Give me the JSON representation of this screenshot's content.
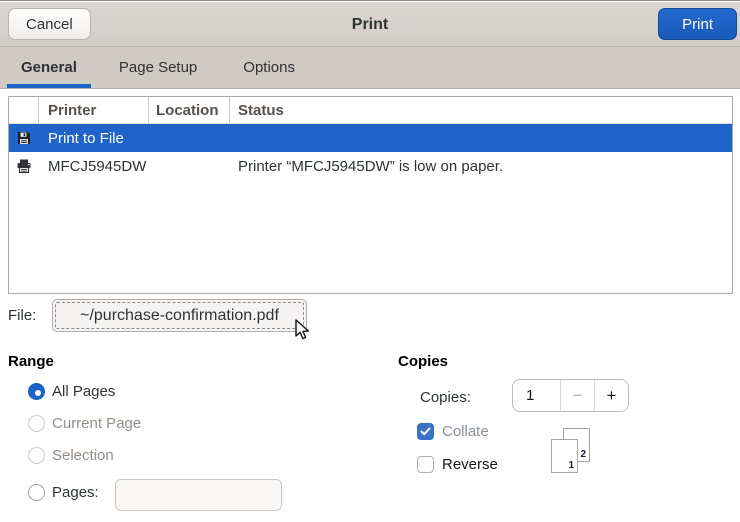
{
  "header": {
    "cancel_label": "Cancel",
    "title": "Print",
    "print_label": "Print"
  },
  "tabs": [
    {
      "label": "General",
      "active": true
    },
    {
      "label": "Page Setup",
      "active": false
    },
    {
      "label": "Options",
      "active": false
    }
  ],
  "printer_table": {
    "columns": {
      "icon": "",
      "printer": "Printer",
      "location": "Location",
      "status": "Status"
    },
    "rows": [
      {
        "icon": "print-to-file-icon",
        "printer": "Print to File",
        "location": "",
        "status": "",
        "selected": true
      },
      {
        "icon": "printer-icon",
        "printer": "MFCJ5945DW",
        "location": "",
        "status": "Printer “MFCJ5945DW” is low on paper.",
        "selected": false
      }
    ]
  },
  "file_row": {
    "label": "File:",
    "button_value": "~/purchase-confirmation.pdf"
  },
  "range": {
    "title": "Range",
    "options": [
      {
        "label": "All Pages",
        "selected": true,
        "enabled": true
      },
      {
        "label": "Current Page",
        "selected": false,
        "enabled": false
      },
      {
        "label": "Selection",
        "selected": false,
        "enabled": false
      },
      {
        "label": "Pages:",
        "selected": false,
        "enabled": true
      }
    ],
    "pages_entry_value": ""
  },
  "copies": {
    "title": "Copies",
    "copies_label": "Copies:",
    "copies_value": "1",
    "minus_label": "−",
    "plus_label": "+",
    "collate": {
      "label": "Collate",
      "checked": true,
      "enabled": false
    },
    "reverse": {
      "label": "Reverse",
      "checked": false,
      "enabled": true
    },
    "collate_icon_numbers": {
      "front": "1",
      "back": "2"
    }
  },
  "colors": {
    "accent_blue": "#1b63c7",
    "selection_blue": "#2064c9",
    "header_bg": "#d5d0cb",
    "tabstrip_bg": "#cfcac4",
    "disabled_text": "#948e87"
  }
}
